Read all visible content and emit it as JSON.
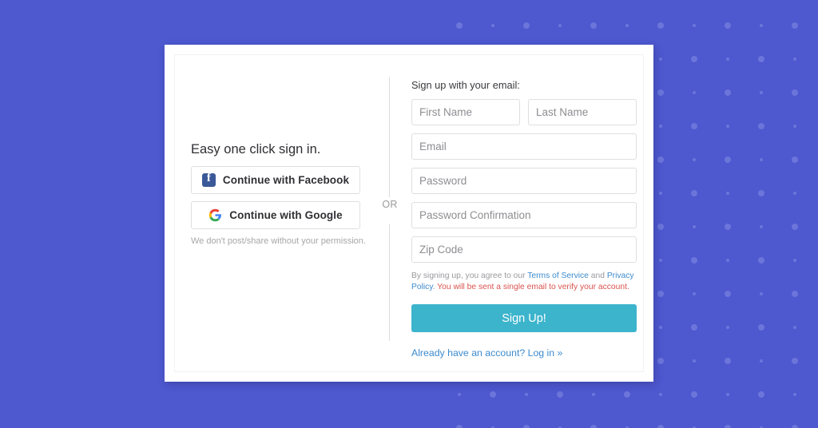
{
  "background": {
    "color": "#4e58cf",
    "dot_color": "#6c75da"
  },
  "left_panel": {
    "heading": "Easy one click sign in.",
    "facebook_button": {
      "label": "Continue with Facebook",
      "icon": "facebook-icon",
      "brand_color": "#3b5998"
    },
    "google_button": {
      "label": "Continue with Google",
      "icon": "google-icon"
    },
    "note": "We don't post/share without your permission."
  },
  "divider": {
    "label": "OR"
  },
  "form": {
    "heading": "Sign up with your email:",
    "fields": [
      {
        "name": "first-name-input",
        "placeholder": "First Name",
        "value": ""
      },
      {
        "name": "last-name-input",
        "placeholder": "Last Name",
        "value": ""
      },
      {
        "name": "email-input",
        "placeholder": "Email",
        "value": ""
      },
      {
        "name": "password-input",
        "placeholder": "Password",
        "value": ""
      },
      {
        "name": "password-confirmation-input",
        "placeholder": "Password Confirmation",
        "value": ""
      },
      {
        "name": "zip-code-input",
        "placeholder": "Zip Code",
        "value": ""
      }
    ],
    "legal": {
      "prefix": "By signing up, you agree to our ",
      "terms_link": "Terms of Service",
      "conjunction": " and ",
      "privacy_link": "Privacy Policy",
      "period": ". ",
      "warning": "You will be sent a single email to verify your account."
    },
    "submit_label": "Sign Up!",
    "submit_color": "#3cb4cc",
    "login_link": "Already have an account? Log in »",
    "link_color": "#3d8bcd"
  }
}
